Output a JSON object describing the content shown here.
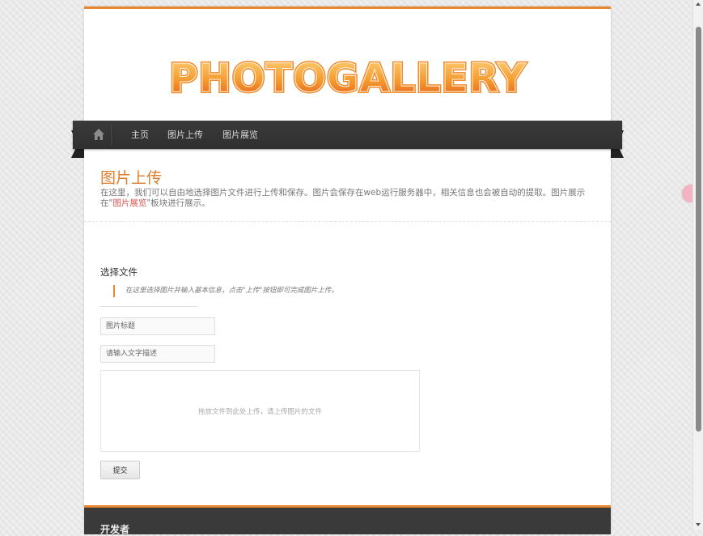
{
  "brand": {
    "logo_text": "PHOTOGALLERY",
    "accent": "#e8872f"
  },
  "nav": {
    "home_icon": "home-icon",
    "items": [
      {
        "label": "主页"
      },
      {
        "label": "图片上传"
      },
      {
        "label": "图片展览"
      }
    ]
  },
  "header": {
    "title": "图片上传",
    "intro_before": "在这里，我们可以自由地选择图片文件进行上传和保存。图片会保存在web运行服务器中，相关信息也会被自动的提取。图片展示在\"",
    "intro_link": "图片展览",
    "intro_after": "\"板块进行展示。"
  },
  "form": {
    "section_title": "选择文件",
    "hint": "在这里选择图片并输入基本信息，点击\"上传\"按钮即可完成图片上传。",
    "title_placeholder": "图片标题",
    "desc_placeholder": "请输入文字描述",
    "dropzone_text": "拖放文件到此处上传，请上传图片的文件",
    "submit_label": "提交"
  },
  "footer": {
    "title": "开发者"
  }
}
